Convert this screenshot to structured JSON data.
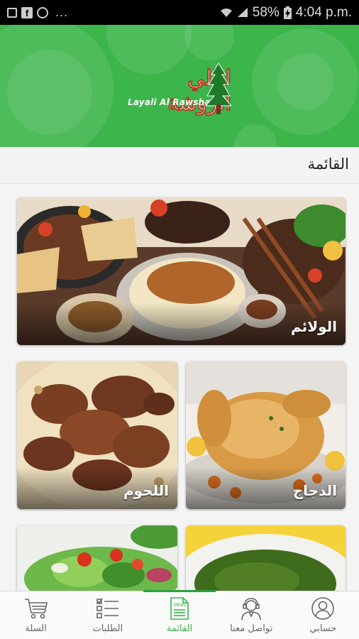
{
  "status_bar": {
    "battery": "58%",
    "time": "4:04 p.m.",
    "overflow": "..."
  },
  "header": {
    "logo_arabic": "ليالي الروشة",
    "logo_latin": "Layali Al Rawsha",
    "background_color": "#3cb54a"
  },
  "section": {
    "title": "القائمة"
  },
  "categories": [
    {
      "label": "الولائم"
    },
    {
      "label": "اللحوم"
    },
    {
      "label": "الدجاج"
    },
    {
      "label": ""
    },
    {
      "label": ""
    }
  ],
  "bottom_nav": {
    "items": [
      {
        "label": "السلة",
        "icon": "cart-icon"
      },
      {
        "label": "الطلبات",
        "icon": "orders-list-icon"
      },
      {
        "label": "القائمة",
        "icon": "menu-icon",
        "active": true
      },
      {
        "label": "تواصل معنا",
        "icon": "support-agent-icon"
      },
      {
        "label": "حسابي",
        "icon": "user-icon"
      }
    ],
    "active_color": "#3cb54a"
  }
}
